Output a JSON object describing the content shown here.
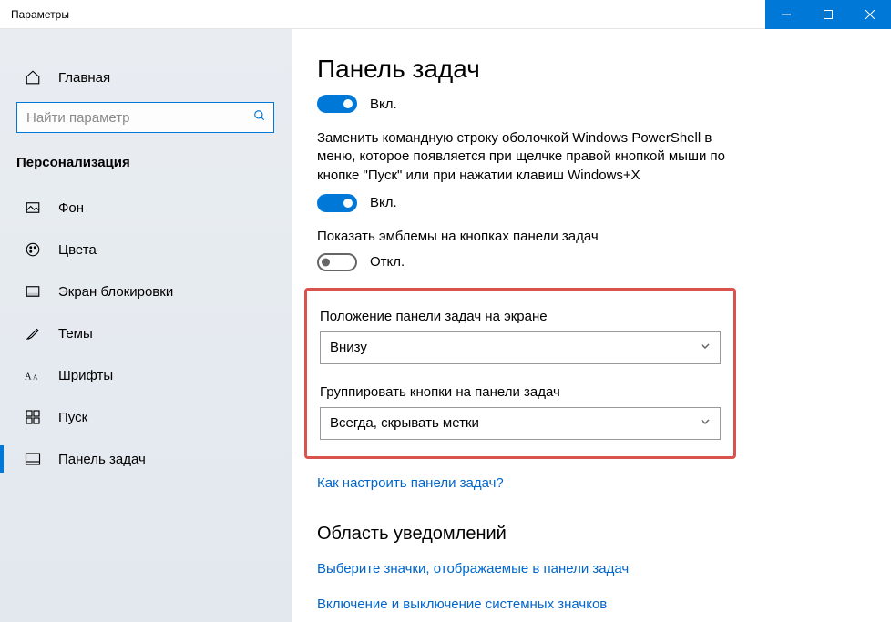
{
  "window": {
    "title": "Параметры"
  },
  "sidebar": {
    "home": "Главная",
    "search_placeholder": "Найти параметр",
    "section": "Персонализация",
    "items": [
      {
        "label": "Фон"
      },
      {
        "label": "Цвета"
      },
      {
        "label": "Экран блокировки"
      },
      {
        "label": "Темы"
      },
      {
        "label": "Шрифты"
      },
      {
        "label": "Пуск"
      },
      {
        "label": "Панель задач"
      }
    ]
  },
  "main": {
    "heading": "Панель задач",
    "toggle1": {
      "state": "Вкл."
    },
    "powershell_desc": "Заменить командную строку оболочкой Windows PowerShell в меню, которое появляется при щелчке правой кнопкой мыши по кнопке \"Пуск\" или при нажатии клавиш Windows+X",
    "toggle2": {
      "state": "Вкл."
    },
    "badges_label": "Показать эмблемы на кнопках панели задач",
    "toggle3": {
      "state": "Откл."
    },
    "position_label": "Положение панели задач на экране",
    "position_value": "Внизу",
    "group_label": "Группировать кнопки на панели задач",
    "group_value": "Всегда, скрывать метки",
    "help_link": "Как настроить панели задач?",
    "notif_heading": "Область уведомлений",
    "notif_link1": "Выберите значки, отображаемые в панели задач",
    "notif_link2": "Включение и выключение системных значков"
  }
}
